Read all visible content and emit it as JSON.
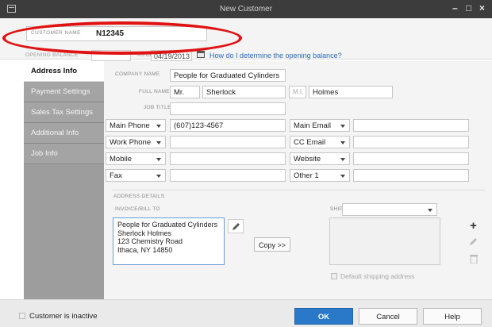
{
  "window": {
    "title": "New Customer",
    "controls": [
      "–",
      "□",
      "×"
    ]
  },
  "customer_name": {
    "label": "CUSTOMER NAME",
    "value": "N12345"
  },
  "opening_balance": {
    "label": "OPENING BALANCE",
    "value": "",
    "as_of_label": "AS OF",
    "as_of_value": "04/19/2013",
    "help_link": "How do I determine the opening balance?"
  },
  "tabs": [
    {
      "label": "Address Info"
    },
    {
      "label": "Payment Settings"
    },
    {
      "label": "Sales Tax Settings"
    },
    {
      "label": "Additional Info"
    },
    {
      "label": "Job Info"
    }
  ],
  "form": {
    "company_name_label": "COMPANY NAME",
    "company_name": "People for Graduated Cylinders",
    "full_name_label": "FULL NAME",
    "salutation": "Mr.",
    "first_name": "Sherlock",
    "mi_placeholder": "M.I.",
    "last_name": "Holmes",
    "job_title_label": "JOB TITLE",
    "job_title": ""
  },
  "contacts_left": [
    {
      "type": "Main Phone",
      "value": "(607)123-4567"
    },
    {
      "type": "Work Phone",
      "value": ""
    },
    {
      "type": "Mobile",
      "value": ""
    },
    {
      "type": "Fax",
      "value": ""
    }
  ],
  "contacts_right": [
    {
      "type": "Main Email",
      "value": ""
    },
    {
      "type": "CC Email",
      "value": ""
    },
    {
      "type": "Website",
      "value": ""
    },
    {
      "type": "Other 1",
      "value": ""
    }
  ],
  "address": {
    "section_label": "ADDRESS DETAILS",
    "bill_to_label": "INVOICE/BILL TO",
    "bill_to_lines": [
      "People for Graduated Cylinders",
      "Sherlock Holmes",
      "123 Chemistry Road",
      "Ithaca, NY 14850"
    ],
    "copy_label": "Copy >>",
    "ship_to_label": "SHIP TO",
    "ship_to_value": "",
    "default_shipping_label": "Default shipping address"
  },
  "footer": {
    "inactive_label": "Customer is inactive",
    "ok_label": "OK",
    "cancel_label": "Cancel",
    "help_label": "Help"
  },
  "colors": {
    "accent": "#2a78c8",
    "highlight": "#e01212",
    "sidebar": "#9d9d9d"
  }
}
